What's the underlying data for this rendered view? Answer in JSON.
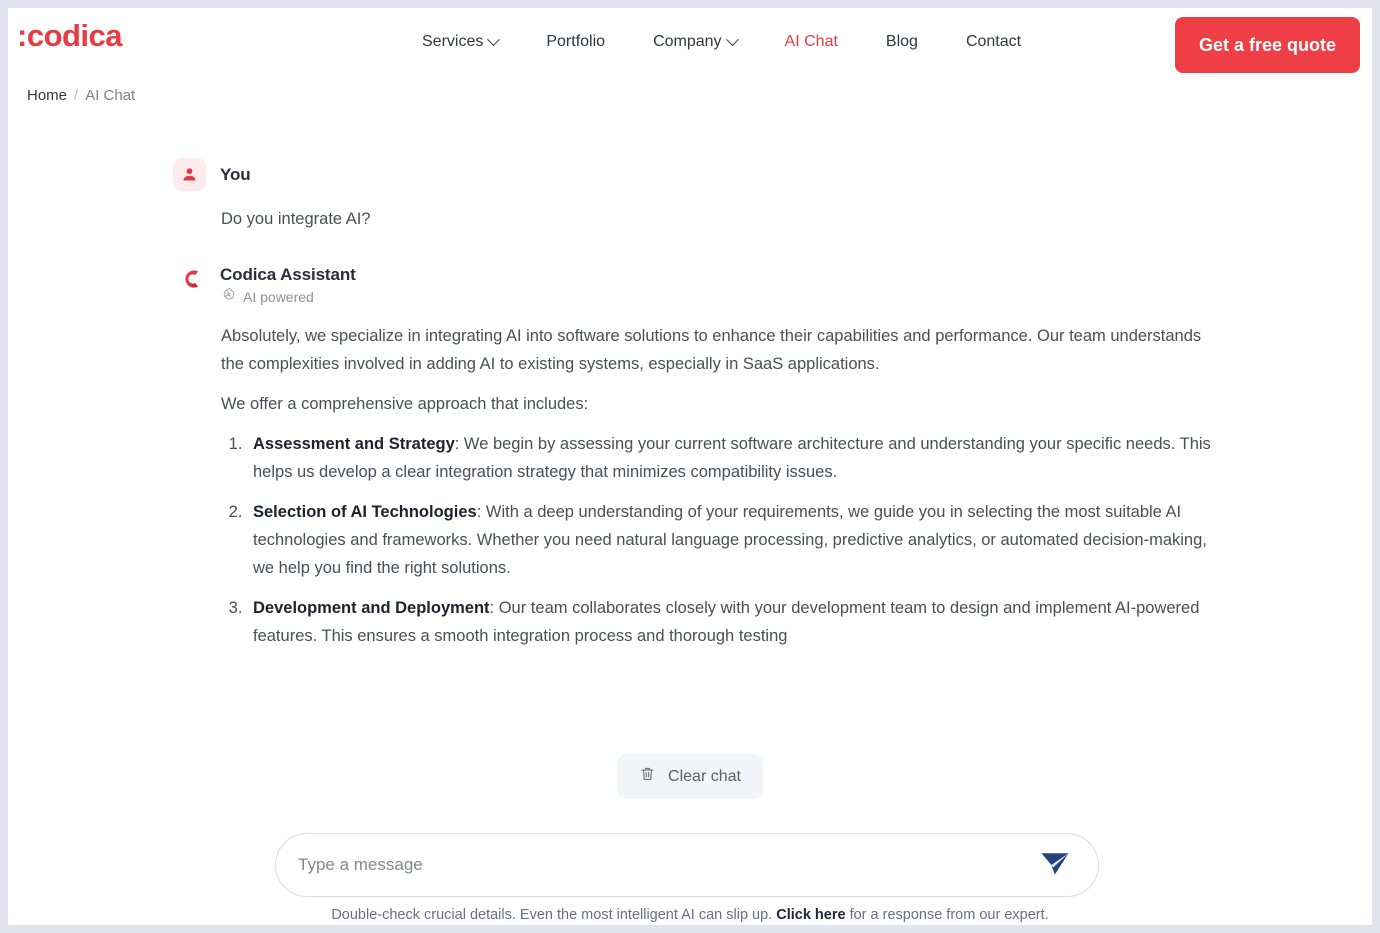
{
  "brand": {
    "logo_text": ":codica",
    "accent": "#ea3a42"
  },
  "nav": {
    "items": [
      {
        "label": "Services",
        "has_caret": true,
        "active": false
      },
      {
        "label": "Portfolio",
        "has_caret": false,
        "active": false
      },
      {
        "label": "Company",
        "has_caret": true,
        "active": false
      },
      {
        "label": "AI Chat",
        "has_caret": false,
        "active": true
      },
      {
        "label": "Blog",
        "has_caret": false,
        "active": false
      },
      {
        "label": "Contact",
        "has_caret": false,
        "active": false
      }
    ],
    "cta_label": "Get a free quote"
  },
  "breadcrumb": {
    "home": "Home",
    "separator": "/",
    "current": "AI Chat"
  },
  "chat": {
    "user": {
      "name": "You",
      "avatar_icon": "user-icon",
      "text": "Do you integrate AI?"
    },
    "assistant": {
      "name": "Codica Assistant",
      "avatar_icon": "codica-c-logo-icon",
      "badge_icon": "openai-icon",
      "badge_label": "AI powered",
      "paragraph_1": "Absolutely, we specialize in integrating AI into software solutions to enhance their capabilities and performance. Our team understands the complexities involved in adding AI to existing systems, especially in SaaS applications.",
      "paragraph_2": "We offer a comprehensive approach that includes:",
      "list": [
        {
          "title": "Assessment and Strategy",
          "body": ": We begin by assessing your current software architecture and understanding your specific needs. This helps us develop a clear integration strategy that minimizes compatibility issues."
        },
        {
          "title": "Selection of AI Technologies",
          "body": ": With a deep understanding of your requirements, we guide you in selecting the most suitable AI technologies and frameworks. Whether you need natural language processing, predictive analytics, or automated decision-making, we help you find the right solutions."
        },
        {
          "title": "Development and Deployment",
          "body": ": Our team collaborates closely with your development team to design and implement AI-powered features. This ensures a smooth integration process and thorough testing"
        }
      ]
    }
  },
  "controls": {
    "clear_chat_label": "Clear chat",
    "clear_chat_icon": "trash-icon",
    "input_placeholder": "Type a message",
    "input_value": "",
    "send_icon": "send-plane-icon",
    "send_color": "#24437e"
  },
  "disclaimer": {
    "before": "Double-check crucial details. Even the most intelligent AI can slip up. ",
    "link": "Click here",
    "after": " for a response from our expert."
  }
}
